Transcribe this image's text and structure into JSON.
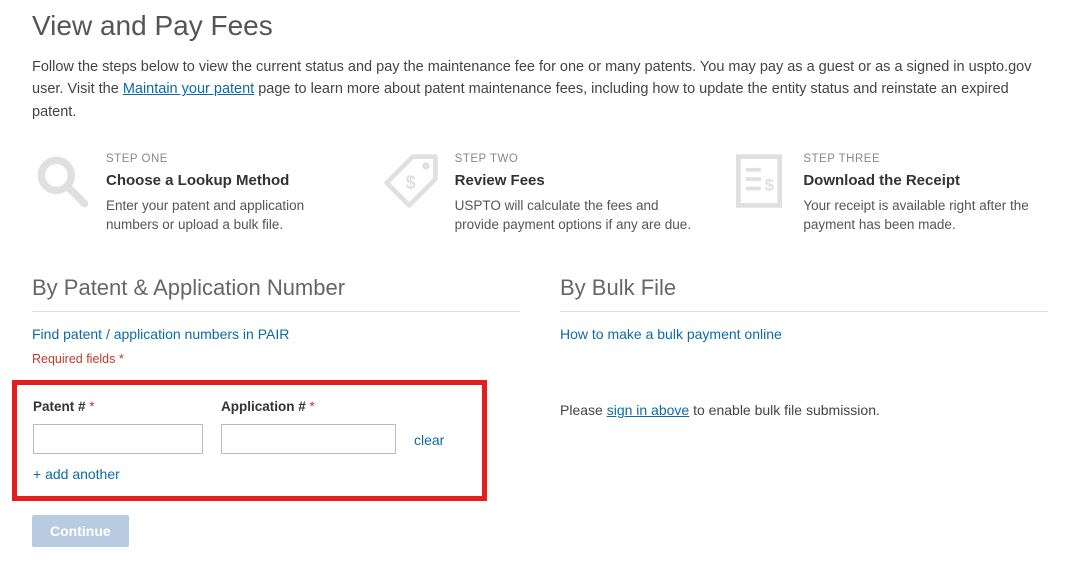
{
  "header": {
    "title": "View and Pay Fees",
    "intro_pre": "Follow the steps below to view the current status and pay the maintenance fee for one or many patents. You may pay as a guest or as a signed in uspto.gov user. Visit the ",
    "intro_link": "Maintain your patent",
    "intro_post": " page to learn more about patent maintenance fees, including how to update the entity status and reinstate an expired patent."
  },
  "steps": [
    {
      "label": "STEP ONE",
      "title": "Choose a Lookup Method",
      "desc": "Enter your patent and application numbers or upload a bulk file."
    },
    {
      "label": "STEP TWO",
      "title": "Review Fees",
      "desc": "USPTO will calculate the fees and provide payment options if any are due."
    },
    {
      "label": "STEP THREE",
      "title": "Download the Receipt",
      "desc": "Your receipt is available right after the payment has been made."
    }
  ],
  "left": {
    "heading": "By Patent & Application Number",
    "help_link": "Find patent / application numbers in PAIR",
    "required_note": "Required fields",
    "patent_label": "Patent #",
    "application_label": "Application #",
    "patent_value": "",
    "application_value": "",
    "clear": "clear",
    "add_another": "+ add another",
    "continue": "Continue"
  },
  "right": {
    "heading": "By Bulk File",
    "help_link": "How to make a bulk payment online",
    "note_pre": "Please ",
    "note_link": "sign in above",
    "note_post": " to enable bulk file submission."
  }
}
